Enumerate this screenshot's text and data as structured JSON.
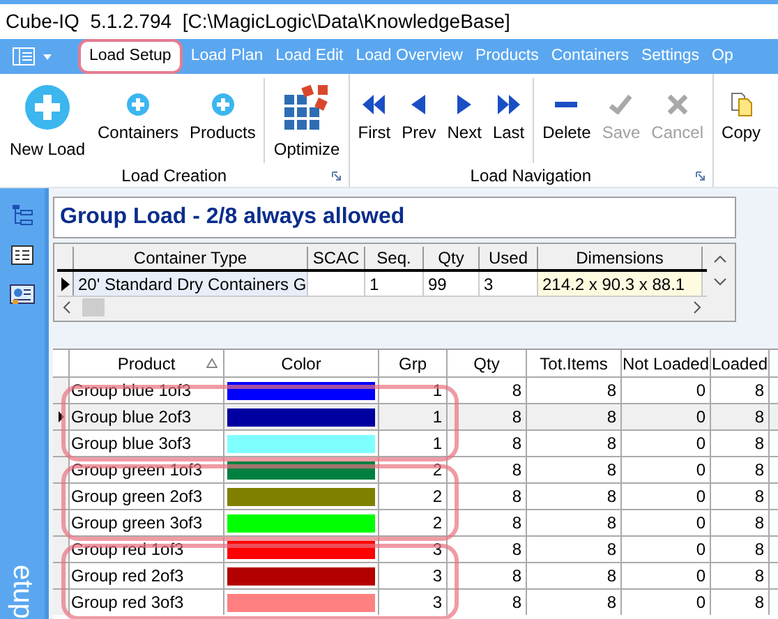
{
  "window": {
    "title": "Cube-IQ  5.1.2.794  [C:\\MagicLogic\\Data\\KnowledgeBase]"
  },
  "tabs": [
    {
      "label": "Load Setup",
      "selected": true
    },
    {
      "label": "Load Plan",
      "selected": false
    },
    {
      "label": "Load Edit",
      "selected": false
    },
    {
      "label": "Load Overview",
      "selected": false
    },
    {
      "label": "Products",
      "selected": false
    },
    {
      "label": "Containers",
      "selected": false
    },
    {
      "label": "Settings",
      "selected": false
    },
    {
      "label": "Op",
      "selected": false
    }
  ],
  "ribbon": {
    "groups": [
      {
        "label": "Load Creation",
        "sections": [
          [
            {
              "label": "New Load",
              "kind": "add-large",
              "disabled": false
            },
            {
              "label": "Containers",
              "kind": "add",
              "disabled": false
            },
            {
              "label": "Products",
              "kind": "add",
              "disabled": false
            }
          ],
          [
            {
              "label": "Optimize",
              "kind": "optimize",
              "disabled": false
            }
          ]
        ]
      },
      {
        "label": "Load Navigation",
        "sections": [
          [
            {
              "label": "First",
              "kind": "first",
              "disabled": false
            },
            {
              "label": "Prev",
              "kind": "prev",
              "disabled": false
            },
            {
              "label": "Next",
              "kind": "next",
              "disabled": false
            },
            {
              "label": "Last",
              "kind": "last",
              "disabled": false
            }
          ],
          [
            {
              "label": "Delete",
              "kind": "delete",
              "disabled": false
            },
            {
              "label": "Save",
              "kind": "save",
              "disabled": true
            },
            {
              "label": "Cancel",
              "kind": "cancel",
              "disabled": true
            }
          ]
        ]
      },
      {
        "sections": [
          [
            {
              "label": "Copy",
              "kind": "copy",
              "disabled": false
            }
          ]
        ]
      }
    ]
  },
  "sidebar": {
    "label": "etup"
  },
  "load_title": "Group Load - 2/8 always allowed",
  "container_table": {
    "columns": [
      "Container Type",
      "SCAC",
      "Seq.",
      "Qty",
      "Used",
      "Dimensions"
    ],
    "rows": [
      {
        "selected": true,
        "cells": [
          "20' Standard Dry Containers G",
          "",
          "1",
          "99",
          "3",
          "214.2 x 90.3 x 88.1"
        ]
      }
    ]
  },
  "product_table": {
    "columns": [
      "Product",
      "Color",
      "Grp",
      "Qty",
      "Tot.Items",
      "Not Loaded",
      "Loaded"
    ],
    "rows": [
      {
        "product": "Group blue 1of3",
        "color": "#0000ff",
        "grp": "1",
        "qty": "8",
        "tot_items": "8",
        "not_loaded": "0",
        "loaded": "8",
        "selected": false
      },
      {
        "product": "Group blue 2of3",
        "color": "#0000a0",
        "grp": "1",
        "qty": "8",
        "tot_items": "8",
        "not_loaded": "0",
        "loaded": "8",
        "selected": true
      },
      {
        "product": "Group blue 3of3",
        "color": "#80ffff",
        "grp": "1",
        "qty": "8",
        "tot_items": "8",
        "not_loaded": "0",
        "loaded": "8",
        "selected": false
      },
      {
        "product": "Group green 1of3",
        "color": "#008040",
        "grp": "2",
        "qty": "8",
        "tot_items": "8",
        "not_loaded": "0",
        "loaded": "8",
        "selected": false
      },
      {
        "product": "Group green 2of3",
        "color": "#808000",
        "grp": "2",
        "qty": "8",
        "tot_items": "8",
        "not_loaded": "0",
        "loaded": "8",
        "selected": false
      },
      {
        "product": "Group green 3of3",
        "color": "#00ff00",
        "grp": "2",
        "qty": "8",
        "tot_items": "8",
        "not_loaded": "0",
        "loaded": "8",
        "selected": false
      },
      {
        "product": "Group red 1of3",
        "color": "#ff0000",
        "grp": "3",
        "qty": "8",
        "tot_items": "8",
        "not_loaded": "0",
        "loaded": "8",
        "selected": false
      },
      {
        "product": "Group red 2of3",
        "color": "#b30000",
        "grp": "3",
        "qty": "8",
        "tot_items": "8",
        "not_loaded": "0",
        "loaded": "8",
        "selected": false
      },
      {
        "product": "Group red 3of3",
        "color": "#ff8080",
        "grp": "3",
        "qty": "8",
        "tot_items": "8",
        "not_loaded": "0",
        "loaded": "8",
        "selected": false
      }
    ]
  }
}
